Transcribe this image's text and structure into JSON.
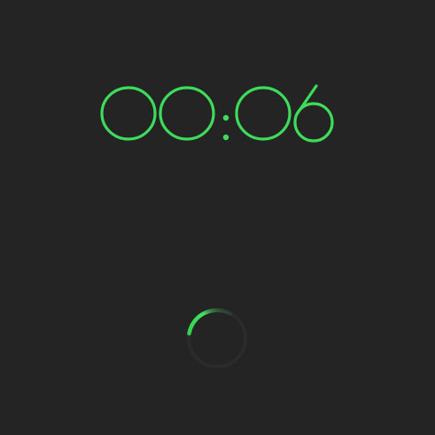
{
  "timer": {
    "display": "00:06",
    "digits": [
      "0",
      "0",
      "6"
    ],
    "separator": ":"
  },
  "spinner": {
    "fraction": 0.3
  },
  "colors": {
    "background": "#242424",
    "accent": "#3ddc5a",
    "track": "#2b2b2b"
  }
}
